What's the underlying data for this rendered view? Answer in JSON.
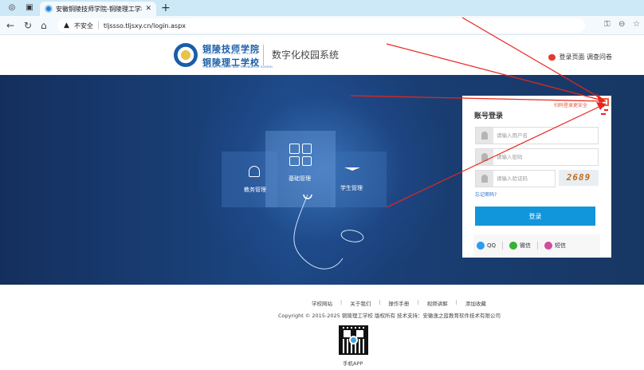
{
  "browser": {
    "tab_title": "安徽铜陵技师学院-铜陵理工学校",
    "insecure_label": "不安全",
    "url": "tljssso.tljsxy.cn/login.aspx"
  },
  "header": {
    "school_cn_1": "铜陵技师学院",
    "school_en_1": "TONGLING TECHNICAL COLLEGE",
    "school_cn_2": "铜陵理工学校",
    "school_en_2": "TONGLING SCIENCE AND TECHNOLOGY SCHOOL",
    "system_name": "数字化校园系统",
    "right_links": "登录页面 调查问卷"
  },
  "banner": {
    "tiles": [
      "教务管理",
      "基础管理",
      "学生管理"
    ]
  },
  "login": {
    "qr_hint": "扫码登录更安全",
    "title": "账号登录",
    "username_placeholder": "请输入用户名",
    "password_placeholder": "请输入密码",
    "captcha_placeholder": "请输入验证码",
    "captcha_text": "2689",
    "forgot": "忘记密码?",
    "submit": "登录",
    "social": [
      "QQ",
      "微信",
      "短信"
    ]
  },
  "footer": {
    "links": [
      "学校网站",
      "关于我们",
      "操作手册",
      "视频讲解",
      "添加收藏"
    ],
    "copyright": "Copyright © 2015-2025  铜陵理工学校 版权所有  技术支持：安徽逸之蓝教育软件技术有限公司",
    "app_label": "手机APP"
  },
  "colors": {
    "accent": "#1296db",
    "banner": "#1c4783",
    "annotation": "#e8261e"
  }
}
